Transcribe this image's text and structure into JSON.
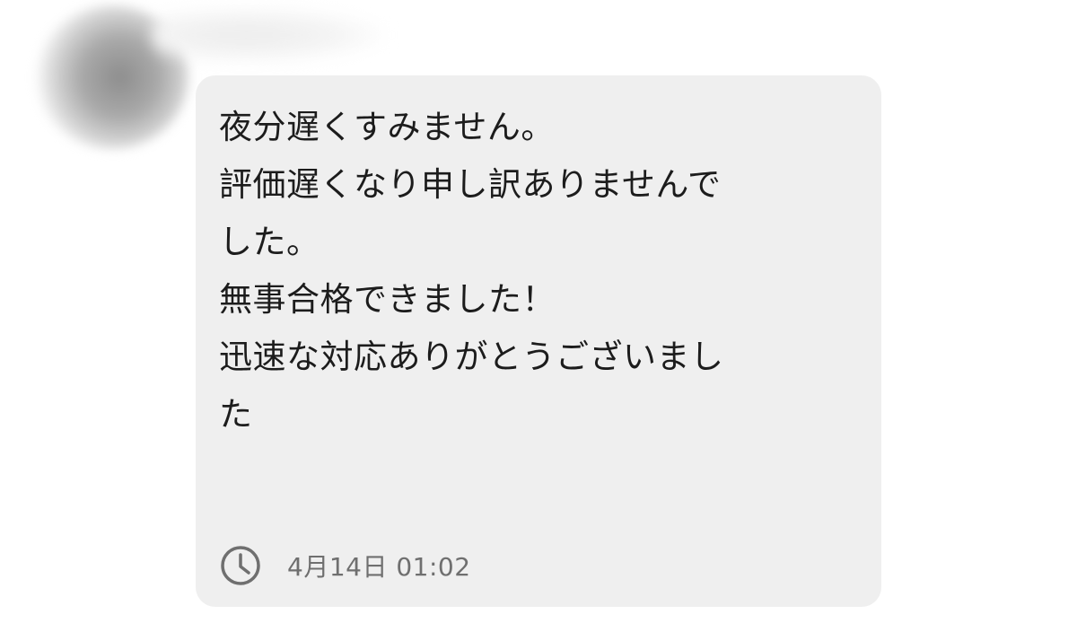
{
  "message": {
    "lines": [
      "夜分遅くすみません。",
      "評価遅くなり申し訳ありませんで",
      "した。",
      "無事合格できました！",
      "迅速な対応ありがとうございまし",
      "た"
    ]
  },
  "meta": {
    "icon": "clock-icon",
    "timestamp": "4月14日 01:02"
  },
  "colors": {
    "bubble_bg": "#efefef",
    "text": "#1c1c1c",
    "timestamp_text": "#6f6f6f",
    "icon": "#6f6f6f"
  }
}
